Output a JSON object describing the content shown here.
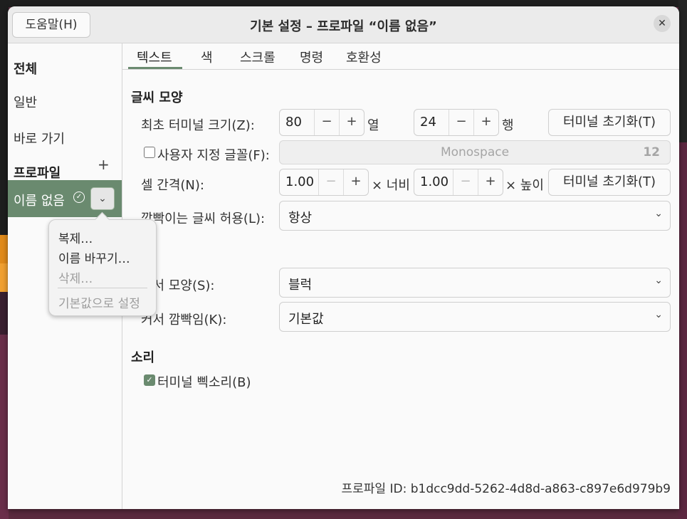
{
  "window": {
    "help_label": "도움말(H)",
    "title": "기본 설정 – 프로파일 “이름 없음”",
    "close_glyph": "✕"
  },
  "sidebar": {
    "all": "전체",
    "general": "일반",
    "shortcuts": "바로 가기",
    "profiles": "프로파일",
    "add_glyph": "+",
    "profile_name": "이름 없음",
    "check_glyph": "✓",
    "menu_glyph": "⌄"
  },
  "popover": {
    "items": [
      "복제…",
      "이름 바꾸기…",
      "삭제…",
      "기본값으로 설정"
    ]
  },
  "tabs": [
    "텍스트",
    "색",
    "스크롤",
    "명령",
    "호환성"
  ],
  "text": {
    "section_appearance": "글씨 모양",
    "initial_size_label": "최초 터미널 크기(Z):",
    "columns_value": "80",
    "columns_unit": "열",
    "rows_value": "24",
    "rows_unit": "행",
    "reset_size_label": "터미널 초기화(T)",
    "custom_font_label": "사용자 지정 글꼴(F):",
    "font_name": "Monospace",
    "font_size": "12",
    "cell_spacing_label": "셀 간격(N):",
    "width_value": "1.00",
    "width_unit": "× 너비",
    "height_value": "1.00",
    "height_unit": "× 높이",
    "reset_spacing_label": "터미널 초기화(T)",
    "blink_text_label": "깜빡이는 글씨 허용(L):",
    "blink_text_value": "항상",
    "cursor_shape_label": "커서 모양(S):",
    "cursor_shape_value": "블럭",
    "cursor_blink_label": "커서 깜빡임(K):",
    "cursor_blink_value": "기본값",
    "section_sound": "소리",
    "bell_label": "터미널 삑소리(B)",
    "minus_glyph": "−",
    "plus_glyph": "+",
    "arrow_glyph": "⌄",
    "checkmark": "✓"
  },
  "footer": {
    "profile_id": "프로파일 ID: b1dcc9dd-5262-4d8d-a863-c897e6d979b9"
  },
  "colors": {
    "accent": "#6a8a6f"
  }
}
